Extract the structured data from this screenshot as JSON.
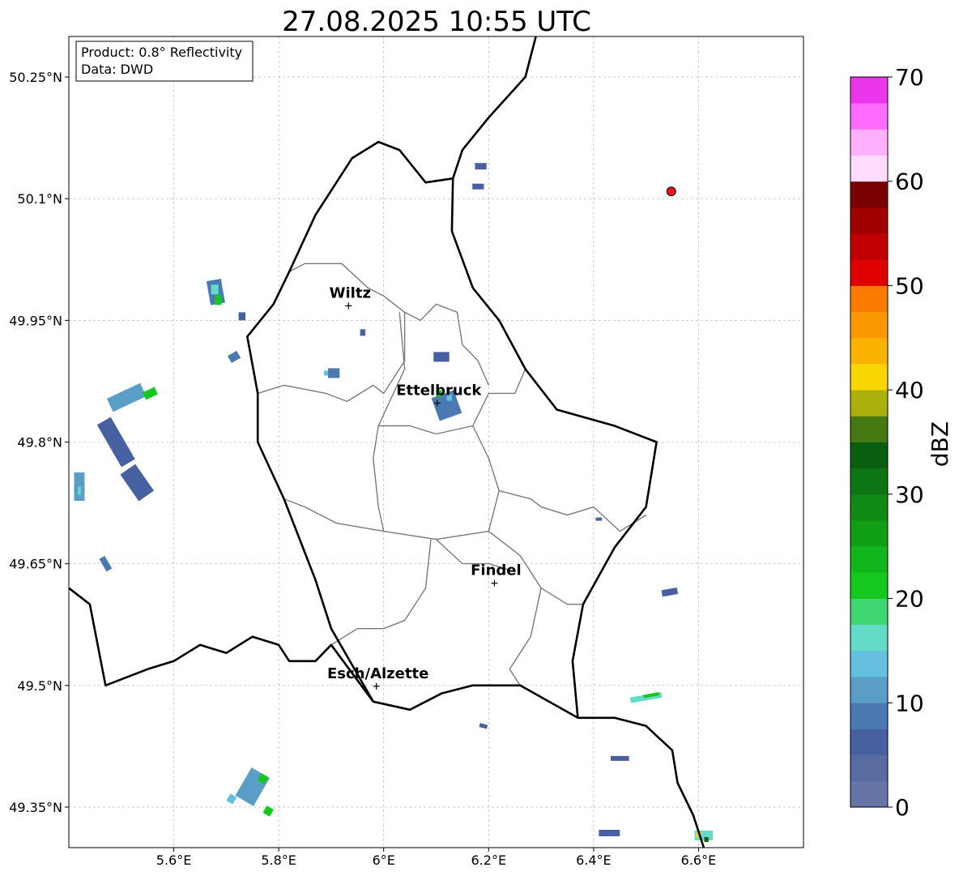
{
  "title": "27.08.2025 10:55 UTC",
  "info_box": {
    "product": "Product: 0.8° Reflectivity",
    "data_source": "Data: DWD"
  },
  "axes": {
    "lon_ticks": [
      {
        "value": 5.6,
        "label": "5.6°E"
      },
      {
        "value": 5.8,
        "label": "5.8°E"
      },
      {
        "value": 6.0,
        "label": "6°E"
      },
      {
        "value": 6.2,
        "label": "6.2°E"
      },
      {
        "value": 6.4,
        "label": "6.4°E"
      },
      {
        "value": 6.6,
        "label": "6.6°E"
      }
    ],
    "lat_ticks": [
      {
        "value": 50.25,
        "label": "50.25°N"
      },
      {
        "value": 50.1,
        "label": "50.1°N"
      },
      {
        "value": 49.95,
        "label": "49.95°N"
      },
      {
        "value": 49.8,
        "label": "49.8°N"
      },
      {
        "value": 49.65,
        "label": "49.65°N"
      },
      {
        "value": 49.5,
        "label": "49.5°N"
      },
      {
        "value": 49.35,
        "label": "49.35°N"
      }
    ],
    "lon_range": [
      5.4,
      6.8
    ],
    "lat_range": [
      49.3,
      50.3
    ],
    "grid": true
  },
  "cities": [
    {
      "name": "Wiltz",
      "lon": 5.933,
      "lat": 49.968
    },
    {
      "name": "Ettelbruck",
      "lon": 6.102,
      "lat": 49.848
    },
    {
      "name": "Findel",
      "lon": 6.211,
      "lat": 49.626
    },
    {
      "name": "Esch/Alzette",
      "lon": 5.986,
      "lat": 49.499
    }
  ],
  "radar_site": {
    "lon": 6.548,
    "lat": 50.109,
    "color": "#e8141c"
  },
  "colorbar": {
    "label": "dBZ",
    "min": 0,
    "max": 70,
    "tick_values": [
      0,
      10,
      20,
      30,
      40,
      50,
      60,
      70
    ],
    "tick_labels": [
      "0",
      "10",
      "20",
      "30",
      "40",
      "50",
      "60",
      "70"
    ],
    "colors": [
      "#6674a6",
      "#586ca2",
      "#4660a2",
      "#4b7ab2",
      "#5a9ec8",
      "#64c0de",
      "#64dac8",
      "#3ed670",
      "#14c81e",
      "#12b61a",
      "#109e14",
      "#108814",
      "#0c7412",
      "#0a5e10",
      "#467814",
      "#acb00c",
      "#fad600",
      "#fab400",
      "#fa9a00",
      "#fc7c00",
      "#e00000",
      "#c00000",
      "#a00000",
      "#780000",
      "#ffdcff",
      "#ffb0ff",
      "#ff6cff",
      "#ec36ec"
    ]
  },
  "echoes": [
    {
      "lon": 5.68,
      "lat": 49.985,
      "rlon": 0.028,
      "rlat": 0.03,
      "dbz": 8,
      "angle": -10
    },
    {
      "lon": 5.685,
      "lat": 49.975,
      "rlon": 0.012,
      "rlat": 0.012,
      "dbz": 22,
      "angle": 0
    },
    {
      "lon": 5.678,
      "lat": 49.988,
      "rlon": 0.014,
      "rlat": 0.012,
      "dbz": 16,
      "angle": 0
    },
    {
      "lon": 5.73,
      "lat": 49.955,
      "rlon": 0.013,
      "rlat": 0.01,
      "dbz": 6,
      "angle": 0
    },
    {
      "lon": 5.715,
      "lat": 49.905,
      "rlon": 0.02,
      "rlat": 0.01,
      "dbz": 8,
      "angle": -30
    },
    {
      "lon": 5.51,
      "lat": 49.855,
      "rlon": 0.07,
      "rlat": 0.018,
      "dbz": 10,
      "angle": -25
    },
    {
      "lon": 5.555,
      "lat": 49.86,
      "rlon": 0.025,
      "rlat": 0.01,
      "dbz": 22,
      "angle": -25
    },
    {
      "lon": 5.49,
      "lat": 49.8,
      "rlon": 0.03,
      "rlat": 0.06,
      "dbz": 6,
      "angle": -30
    },
    {
      "lon": 5.53,
      "lat": 49.75,
      "rlon": 0.035,
      "rlat": 0.04,
      "dbz": 6,
      "angle": -35
    },
    {
      "lon": 5.42,
      "lat": 49.745,
      "rlon": 0.02,
      "rlat": 0.035,
      "dbz": 10,
      "angle": 0
    },
    {
      "lon": 5.42,
      "lat": 49.74,
      "rlon": 0.006,
      "rlat": 0.01,
      "dbz": 16,
      "angle": 0
    },
    {
      "lon": 5.47,
      "lat": 49.65,
      "rlon": 0.012,
      "rlat": 0.018,
      "dbz": 8,
      "angle": -30
    },
    {
      "lon": 5.905,
      "lat": 49.885,
      "rlon": 0.022,
      "rlat": 0.012,
      "dbz": 8,
      "angle": 0
    },
    {
      "lon": 5.89,
      "lat": 49.885,
      "rlon": 0.008,
      "rlat": 0.006,
      "dbz": 14,
      "angle": 0
    },
    {
      "lon": 5.96,
      "lat": 49.935,
      "rlon": 0.01,
      "rlat": 0.008,
      "dbz": 6,
      "angle": 0
    },
    {
      "lon": 6.11,
      "lat": 49.905,
      "rlon": 0.03,
      "rlat": 0.012,
      "dbz": 6,
      "angle": 0
    },
    {
      "lon": 6.12,
      "lat": 49.845,
      "rlon": 0.045,
      "rlat": 0.03,
      "dbz": 8,
      "angle": -20
    },
    {
      "lon": 6.105,
      "lat": 49.86,
      "rlon": 0.01,
      "rlat": 0.008,
      "dbz": 22,
      "angle": 0
    },
    {
      "lon": 6.125,
      "lat": 49.855,
      "rlon": 0.01,
      "rlat": 0.008,
      "dbz": 14,
      "angle": 0
    },
    {
      "lon": 6.185,
      "lat": 50.14,
      "rlon": 0.022,
      "rlat": 0.008,
      "dbz": 6,
      "angle": 0
    },
    {
      "lon": 6.18,
      "lat": 50.115,
      "rlon": 0.022,
      "rlat": 0.007,
      "dbz": 6,
      "angle": 0
    },
    {
      "lon": 6.41,
      "lat": 49.705,
      "rlon": 0.012,
      "rlat": 0.004,
      "dbz": 6,
      "angle": 0
    },
    {
      "lon": 6.545,
      "lat": 49.615,
      "rlon": 0.03,
      "rlat": 0.008,
      "dbz": 6,
      "angle": -10
    },
    {
      "lon": 6.5,
      "lat": 49.485,
      "rlon": 0.06,
      "rlat": 0.007,
      "dbz": 16,
      "angle": -10
    },
    {
      "lon": 6.51,
      "lat": 49.488,
      "rlon": 0.03,
      "rlat": 0.004,
      "dbz": 22,
      "angle": -10
    },
    {
      "lon": 6.19,
      "lat": 49.45,
      "rlon": 0.015,
      "rlat": 0.005,
      "dbz": 6,
      "angle": 15
    },
    {
      "lon": 6.45,
      "lat": 49.41,
      "rlon": 0.035,
      "rlat": 0.006,
      "dbz": 6,
      "angle": 0
    },
    {
      "lon": 5.75,
      "lat": 49.375,
      "rlon": 0.04,
      "rlat": 0.04,
      "dbz": 10,
      "angle": 30
    },
    {
      "lon": 5.77,
      "lat": 49.385,
      "rlon": 0.015,
      "rlat": 0.01,
      "dbz": 22,
      "angle": 30
    },
    {
      "lon": 5.78,
      "lat": 49.345,
      "rlon": 0.015,
      "rlat": 0.01,
      "dbz": 20,
      "angle": 30
    },
    {
      "lon": 5.71,
      "lat": 49.36,
      "rlon": 0.014,
      "rlat": 0.01,
      "dbz": 14,
      "angle": 30
    },
    {
      "lon": 6.43,
      "lat": 49.318,
      "rlon": 0.04,
      "rlat": 0.008,
      "dbz": 6,
      "angle": 0
    },
    {
      "lon": 6.61,
      "lat": 49.315,
      "rlon": 0.035,
      "rlat": 0.012,
      "dbz": 16,
      "angle": 0
    },
    {
      "lon": 6.6,
      "lat": 49.316,
      "rlon": 0.01,
      "rlat": 0.007,
      "dbz": 42,
      "angle": 0
    },
    {
      "lon": 6.615,
      "lat": 49.31,
      "rlon": 0.008,
      "rlat": 0.006,
      "dbz": 33,
      "angle": 0
    }
  ],
  "borders": {
    "luxembourg": [
      [
        6.132,
        50.125
      ],
      [
        6.08,
        50.12
      ],
      [
        6.03,
        50.16
      ],
      [
        5.99,
        50.17
      ],
      [
        5.94,
        50.15
      ],
      [
        5.9,
        50.11
      ],
      [
        5.87,
        50.08
      ],
      [
        5.82,
        50.01
      ],
      [
        5.79,
        49.97
      ],
      [
        5.74,
        49.93
      ],
      [
        5.76,
        49.86
      ],
      [
        5.76,
        49.8
      ],
      [
        5.81,
        49.73
      ],
      [
        5.87,
        49.63
      ],
      [
        5.9,
        49.57
      ],
      [
        5.98,
        49.48
      ],
      [
        6.05,
        49.47
      ],
      [
        6.11,
        49.49
      ],
      [
        6.17,
        49.5
      ],
      [
        6.26,
        49.5
      ],
      [
        6.37,
        49.46
      ],
      [
        6.36,
        49.53
      ],
      [
        6.38,
        49.6
      ],
      [
        6.44,
        49.67
      ],
      [
        6.5,
        49.72
      ],
      [
        6.52,
        49.8
      ],
      [
        6.44,
        49.82
      ],
      [
        6.33,
        49.84
      ],
      [
        6.27,
        49.89
      ],
      [
        6.22,
        49.95
      ],
      [
        6.17,
        49.99
      ],
      [
        6.13,
        50.06
      ],
      [
        6.132,
        50.125
      ]
    ],
    "germany_east": [
      [
        6.29,
        50.3
      ],
      [
        6.27,
        50.25
      ],
      [
        6.2,
        50.2
      ],
      [
        6.15,
        50.16
      ],
      [
        6.132,
        50.125
      ]
    ],
    "france_southeast": [
      [
        6.37,
        49.46
      ],
      [
        6.44,
        49.46
      ],
      [
        6.5,
        49.45
      ],
      [
        6.55,
        49.42
      ],
      [
        6.56,
        49.38
      ],
      [
        6.59,
        49.34
      ],
      [
        6.61,
        49.3
      ]
    ],
    "belgium_france": [
      [
        5.4,
        49.62
      ],
      [
        5.44,
        49.6
      ],
      [
        5.47,
        49.5
      ],
      [
        5.55,
        49.52
      ],
      [
        5.6,
        49.53
      ],
      [
        5.65,
        49.55
      ],
      [
        5.7,
        49.54
      ],
      [
        5.75,
        49.56
      ],
      [
        5.8,
        49.55
      ],
      [
        5.82,
        49.53
      ],
      [
        5.87,
        49.53
      ],
      [
        5.9,
        49.55
      ],
      [
        5.98,
        49.48
      ]
    ]
  },
  "cantons": [
    [
      [
        5.82,
        50.01
      ],
      [
        5.85,
        50.02
      ],
      [
        5.92,
        50.02
      ],
      [
        5.97,
        49.99
      ],
      [
        6.0,
        49.98
      ],
      [
        6.04,
        49.96
      ]
    ],
    [
      [
        6.04,
        49.96
      ],
      [
        6.04,
        49.9
      ],
      [
        6.0,
        49.86
      ],
      [
        5.98,
        49.87
      ],
      [
        5.93,
        49.85
      ],
      [
        5.89,
        49.86
      ],
      [
        5.81,
        49.87
      ],
      [
        5.76,
        49.86
      ]
    ],
    [
      [
        6.04,
        49.96
      ],
      [
        6.07,
        49.95
      ],
      [
        6.1,
        49.97
      ],
      [
        6.14,
        49.96
      ],
      [
        6.15,
        49.92
      ],
      [
        6.18,
        49.9
      ],
      [
        6.2,
        49.87
      ]
    ],
    [
      [
        6.03,
        49.96
      ],
      [
        6.04,
        49.89
      ],
      [
        5.99,
        49.82
      ],
      [
        6.05,
        49.82
      ],
      [
        6.1,
        49.81
      ],
      [
        6.17,
        49.82
      ],
      [
        6.2,
        49.86
      ],
      [
        6.25,
        49.86
      ],
      [
        6.27,
        49.89
      ]
    ],
    [
      [
        5.99,
        49.82
      ],
      [
        5.98,
        49.78
      ],
      [
        5.99,
        49.72
      ],
      [
        6.0,
        49.69
      ]
    ],
    [
      [
        6.17,
        49.82
      ],
      [
        6.2,
        49.78
      ],
      [
        6.22,
        49.74
      ],
      [
        6.28,
        49.73
      ],
      [
        6.3,
        49.72
      ],
      [
        6.35,
        49.71
      ],
      [
        6.4,
        49.72
      ],
      [
        6.45,
        49.69
      ],
      [
        6.5,
        49.71
      ]
    ],
    [
      [
        5.81,
        49.73
      ],
      [
        5.85,
        49.72
      ],
      [
        5.91,
        49.7
      ],
      [
        6.0,
        49.69
      ],
      [
        6.1,
        49.68
      ],
      [
        6.2,
        49.69
      ],
      [
        6.22,
        49.74
      ]
    ],
    [
      [
        6.09,
        49.68
      ],
      [
        6.08,
        49.62
      ],
      [
        6.04,
        49.58
      ],
      [
        6.0,
        49.57
      ],
      [
        5.95,
        49.57
      ],
      [
        5.9,
        49.55
      ]
    ],
    [
      [
        6.2,
        49.69
      ],
      [
        6.26,
        49.66
      ],
      [
        6.3,
        49.62
      ],
      [
        6.35,
        49.6
      ],
      [
        6.38,
        49.6
      ]
    ],
    [
      [
        6.3,
        49.62
      ],
      [
        6.28,
        49.56
      ],
      [
        6.24,
        49.52
      ],
      [
        6.26,
        49.5
      ]
    ],
    [
      [
        6.1,
        49.68
      ],
      [
        6.15,
        49.65
      ],
      [
        6.2,
        49.65
      ],
      [
        6.25,
        49.64
      ]
    ]
  ]
}
